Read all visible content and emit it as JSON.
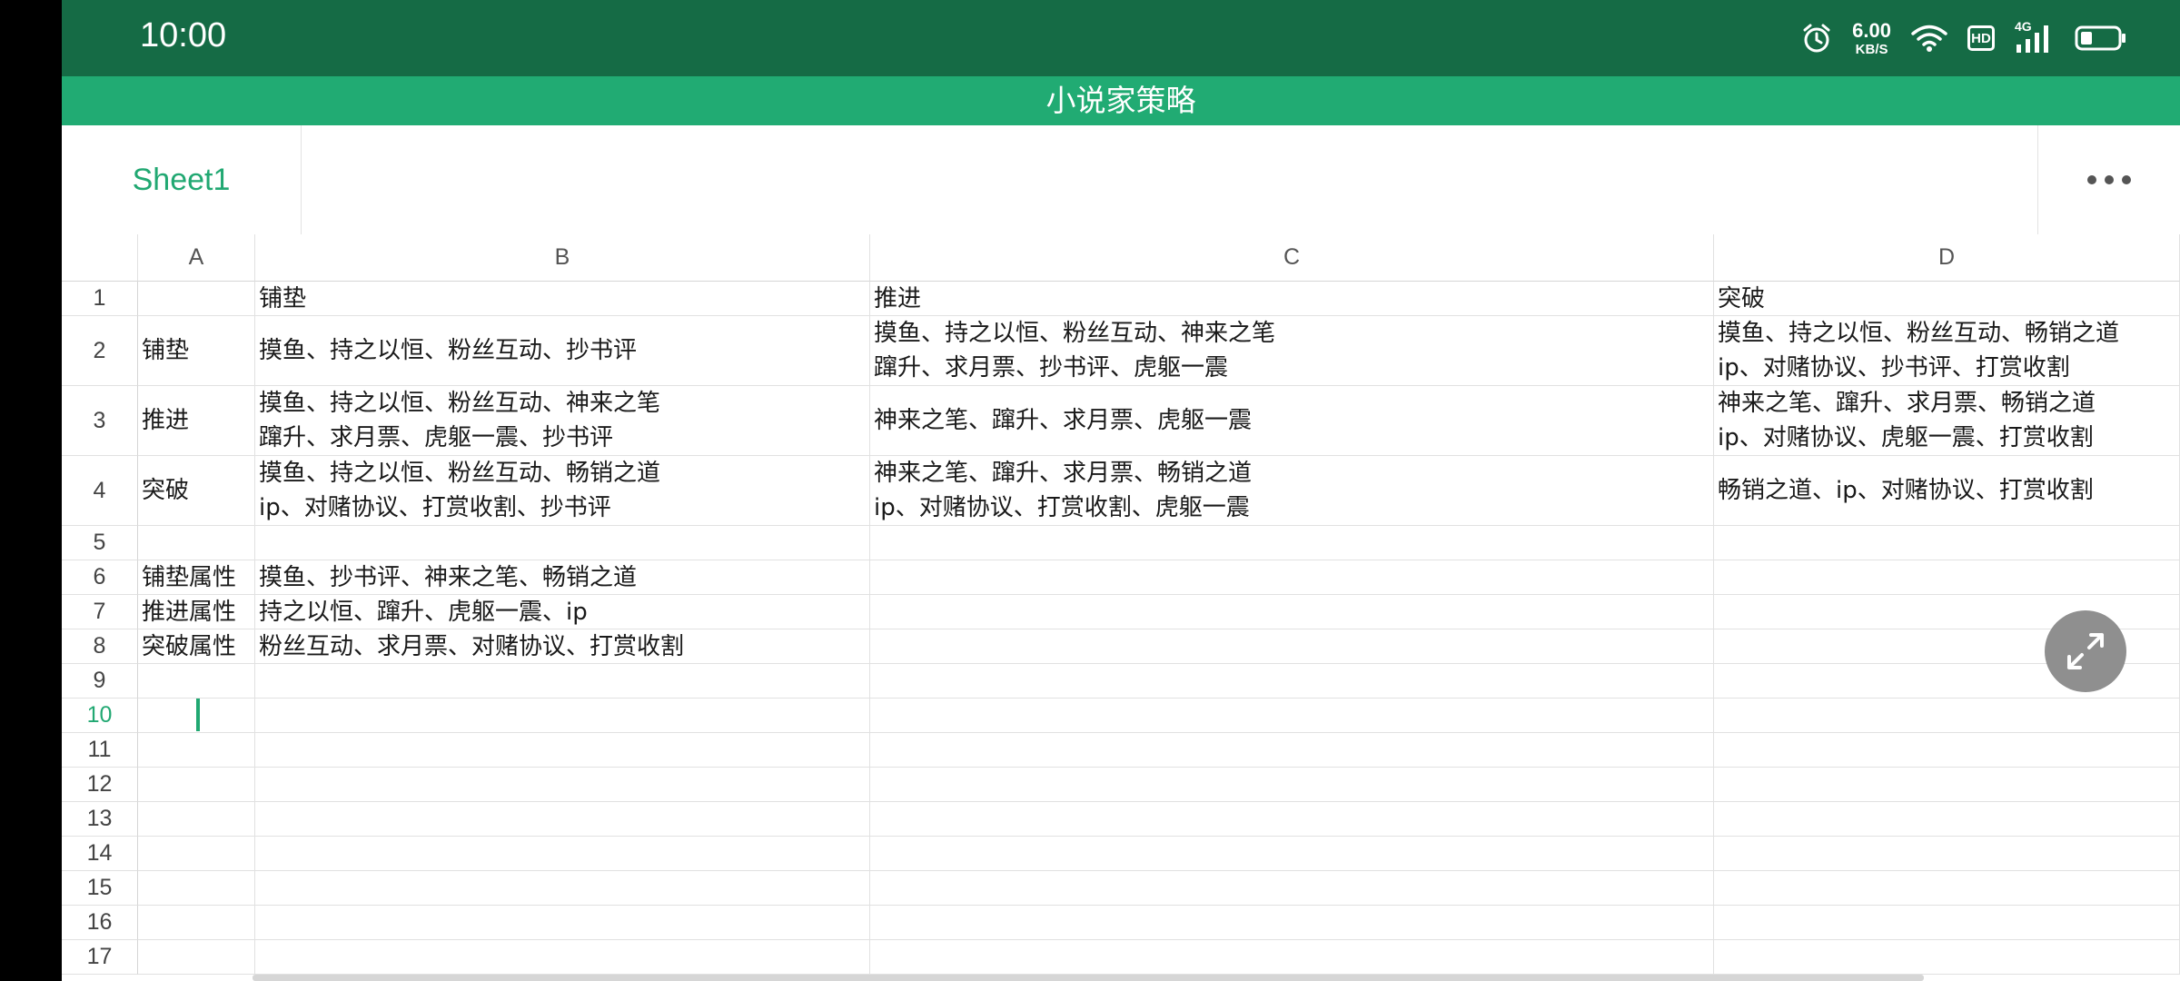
{
  "status_bar": {
    "time": "10:00",
    "net_speed_value": "6.00",
    "net_speed_unit": "KB/S",
    "hd_label": "HD",
    "signal_label": "4G",
    "icons": [
      "alarm-icon",
      "wifi-icon",
      "hd-icon",
      "signal-4g-icon",
      "battery-icon"
    ]
  },
  "title_bar": {
    "title": "小说家策略"
  },
  "tab_bar": {
    "sheet_tab": "Sheet1",
    "more_icon": "more-dots-icon"
  },
  "grid": {
    "columns": [
      "A",
      "B",
      "C",
      "D"
    ],
    "row_numbers": [
      "1",
      "2",
      "3",
      "4",
      "5",
      "6",
      "7",
      "8",
      "9",
      "10",
      "11",
      "12",
      "13",
      "14",
      "15",
      "16",
      "17"
    ],
    "active_row": "10",
    "rows": [
      [
        "",
        "铺垫",
        "推进",
        "突破"
      ],
      [
        "铺垫",
        "摸鱼、持之以恒、粉丝互动、抄书评",
        "摸鱼、持之以恒、粉丝互动、神来之笔\n蹿升、求月票、抄书评、虎躯一震",
        "摸鱼、持之以恒、粉丝互动、畅销之道\nip、对赌协议、抄书评、打赏收割"
      ],
      [
        "推进",
        "摸鱼、持之以恒、粉丝互动、神来之笔\n蹿升、求月票、虎躯一震、抄书评",
        "神来之笔、蹿升、求月票、虎躯一震",
        "神来之笔、蹿升、求月票、畅销之道\nip、对赌协议、虎躯一震、打赏收割"
      ],
      [
        "突破",
        "摸鱼、持之以恒、粉丝互动、畅销之道\nip、对赌协议、打赏收割、抄书评",
        "神来之笔、蹿升、求月票、畅销之道\nip、对赌协议、打赏收割、虎躯一震",
        "畅销之道、ip、对赌协议、打赏收割"
      ],
      [
        "",
        "",
        "",
        ""
      ],
      [
        "铺垫属性",
        "摸鱼、抄书评、神来之笔、畅销之道",
        "",
        ""
      ],
      [
        "推进属性",
        "持之以恒、蹿升、虎躯一震、ip",
        "",
        ""
      ],
      [
        "突破属性",
        "粉丝互动、求月票、对赌协议、打赏收割",
        "",
        ""
      ],
      [
        "",
        "",
        "",
        ""
      ],
      [
        "",
        "",
        "",
        ""
      ],
      [
        "",
        "",
        "",
        ""
      ],
      [
        "",
        "",
        "",
        ""
      ],
      [
        "",
        "",
        "",
        ""
      ],
      [
        "",
        "",
        "",
        ""
      ],
      [
        "",
        "",
        "",
        ""
      ],
      [
        "",
        "",
        "",
        ""
      ],
      [
        "",
        "",
        "",
        ""
      ]
    ]
  },
  "fullscreen_button": {
    "icon": "expand-arrows-icon"
  },
  "colors": {
    "status_bar": "#156b45",
    "title_bar": "#21ab73",
    "accent": "#21a872"
  }
}
